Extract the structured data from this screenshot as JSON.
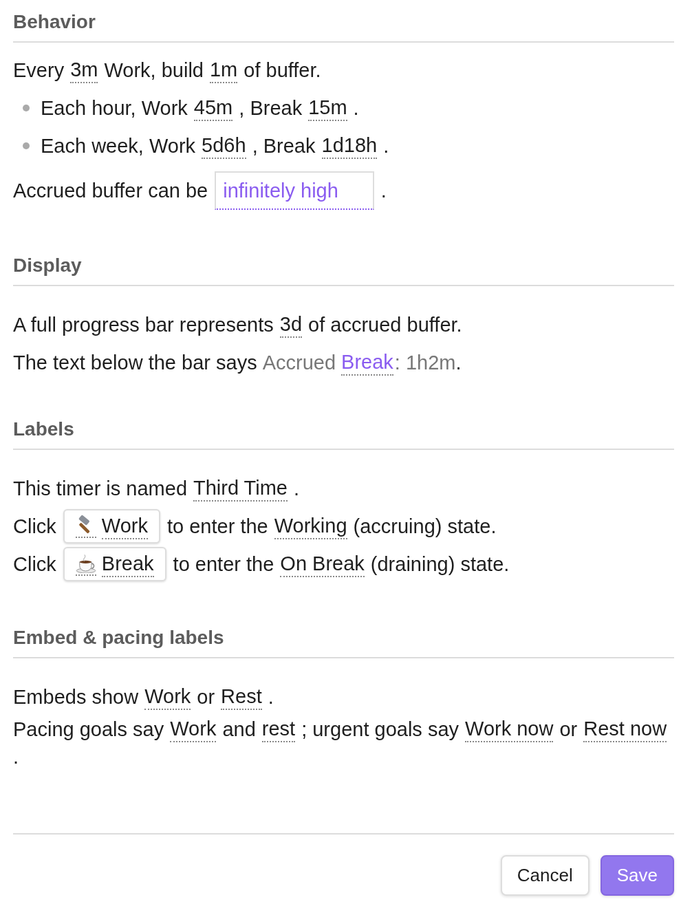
{
  "sections": [
    {
      "heading": "Behavior",
      "lines": [
        {
          "bullet": false,
          "segments": [
            {
              "kind": "text",
              "text": "Every"
            },
            {
              "kind": "value",
              "text": "3m"
            },
            {
              "kind": "text",
              "text": "Work, build"
            },
            {
              "kind": "value",
              "text": "1m"
            },
            {
              "kind": "text",
              "text": "of buffer."
            }
          ]
        },
        {
          "bullet": true,
          "segments": [
            {
              "kind": "text",
              "text": "Each hour, Work"
            },
            {
              "kind": "value",
              "text": "45m"
            },
            {
              "kind": "text",
              "text": ", Break"
            },
            {
              "kind": "value",
              "text": "15m"
            },
            {
              "kind": "text",
              "text": "."
            }
          ]
        },
        {
          "bullet": true,
          "segments": [
            {
              "kind": "text",
              "text": "Each week, Work"
            },
            {
              "kind": "value",
              "text": "5d6h"
            },
            {
              "kind": "text",
              "text": ", Break"
            },
            {
              "kind": "value",
              "text": "1d18h"
            },
            {
              "kind": "text",
              "text": "."
            }
          ]
        },
        {
          "bullet": false,
          "segments": [
            {
              "kind": "text",
              "text": "Accrued buffer can be"
            },
            {
              "kind": "select",
              "text": "infinitely high"
            },
            {
              "kind": "text",
              "text": "."
            }
          ]
        }
      ]
    },
    {
      "heading": "Display",
      "lines": [
        {
          "bullet": false,
          "segments": [
            {
              "kind": "text",
              "text": "A full progress bar represents"
            },
            {
              "kind": "value",
              "text": "3d"
            },
            {
              "kind": "text",
              "text": "of accrued buffer."
            }
          ]
        },
        {
          "bullet": false,
          "segments": [
            {
              "kind": "text",
              "text": "The text below the bar says "
            },
            {
              "kind": "muted",
              "text": "Accrued"
            },
            {
              "kind": "accent",
              "text": "Break"
            },
            {
              "kind": "muted",
              "text": ": 1h2m"
            },
            {
              "kind": "text",
              "text": "."
            }
          ]
        }
      ]
    },
    {
      "heading": "Labels",
      "lines": [
        {
          "bullet": false,
          "segments": [
            {
              "kind": "text",
              "text": "This timer is named"
            },
            {
              "kind": "value",
              "text": "Third Time"
            },
            {
              "kind": "text",
              "text": "."
            }
          ]
        },
        {
          "bullet": false,
          "segments": [
            {
              "kind": "text",
              "text": "Click"
            },
            {
              "kind": "button",
              "text": "Work"
            },
            {
              "kind": "text",
              "text": "to enter the"
            },
            {
              "kind": "value",
              "text": "Working"
            },
            {
              "kind": "text",
              "text": "(accruing) state."
            }
          ]
        },
        {
          "bullet": false,
          "segments": [
            {
              "kind": "text",
              "text": "Click"
            },
            {
              "kind": "button",
              "text": "Break"
            },
            {
              "kind": "text",
              "text": "to enter the"
            },
            {
              "kind": "value",
              "text": "On Break"
            },
            {
              "kind": "text",
              "text": "(draining) state."
            }
          ]
        }
      ]
    },
    {
      "heading": "Embed & pacing labels",
      "lines": [
        {
          "bullet": false,
          "segments": [
            {
              "kind": "text",
              "text": "Embeds show"
            },
            {
              "kind": "value",
              "text": "Work"
            },
            {
              "kind": "text",
              "text": "or"
            },
            {
              "kind": "value",
              "text": "Rest"
            },
            {
              "kind": "text",
              "text": "."
            }
          ]
        },
        {
          "bullet": false,
          "segments": [
            {
              "kind": "text",
              "text": "Pacing goals say"
            },
            {
              "kind": "value",
              "text": "Work"
            },
            {
              "kind": "text",
              "text": "and"
            },
            {
              "kind": "value",
              "text": "rest"
            },
            {
              "kind": "text",
              "text": "; urgent goals say"
            },
            {
              "kind": "value",
              "text": "Work now"
            },
            {
              "kind": "text",
              "text": "or"
            },
            {
              "kind": "value",
              "text": "Rest now"
            },
            {
              "kind": "text",
              "text": "."
            }
          ]
        }
      ]
    }
  ],
  "buttons": [
    {
      "label": "Cancel",
      "primary": false
    },
    {
      "label": "Save",
      "primary": true
    }
  ]
}
